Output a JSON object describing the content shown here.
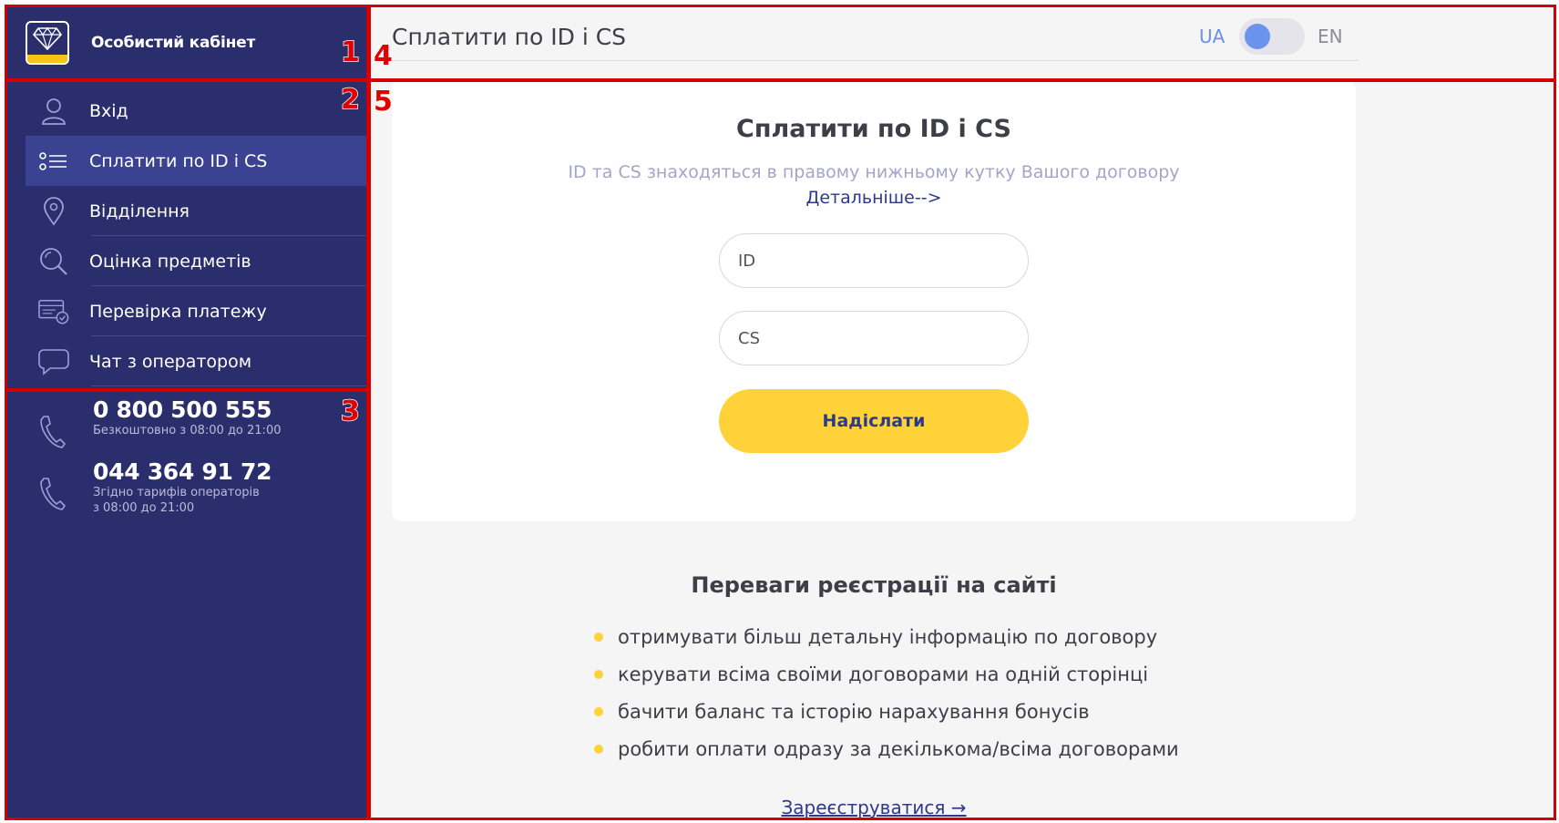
{
  "brand": {
    "title": "Особистий кабінет"
  },
  "nav": {
    "items": [
      {
        "label": "Вхід",
        "icon": "user-icon"
      },
      {
        "label": "Сплатити по ID і CS",
        "icon": "list-icon"
      },
      {
        "label": "Відділення",
        "icon": "location-pin-icon"
      },
      {
        "label": "Оцінка предметів",
        "icon": "magnifier-icon"
      },
      {
        "label": "Перевірка платежу",
        "icon": "payment-check-icon"
      },
      {
        "label": "Чат з оператором",
        "icon": "chat-bubble-icon"
      }
    ]
  },
  "contacts": [
    {
      "number": "0 800 500 555",
      "note1": "Безкоштовно з 08:00 до 21:00",
      "note2": ""
    },
    {
      "number": "044 364 91 72",
      "note1": "Згідно тарифів операторів",
      "note2": "з 08:00 до 21:00"
    }
  ],
  "header": {
    "title": "Сплатити по ID і CS",
    "lang_ua": "UA",
    "lang_en": "EN"
  },
  "card": {
    "title": "Сплатити по ID і CS",
    "hint": "ID та CS знаходяться в правому нижньому кутку Вашого договору",
    "more_link": "Детальніше-->",
    "id_placeholder": "ID",
    "cs_placeholder": "CS",
    "submit_label": "Надіслати"
  },
  "benefits": {
    "title": "Переваги реєстрації на сайті",
    "items": [
      "отримувати більш детальну інформацію по договору",
      "керувати всіма своїми договорами на одній сторінці",
      "бачити баланс та історію нарахування бонусів",
      "робити оплати одразу за декількома/всіма договорами"
    ],
    "register_link": "Зареєструватися →"
  },
  "annotations": [
    "1",
    "2",
    "3",
    "4",
    "5"
  ],
  "colors": {
    "sidebar": "#2b2e6c",
    "accent": "#ffd23a",
    "link": "#2d3a8c",
    "frame": "#d40000"
  }
}
